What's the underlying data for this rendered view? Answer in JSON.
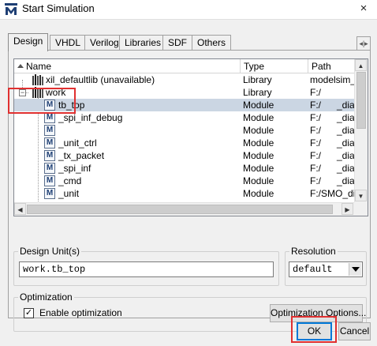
{
  "window": {
    "title": "Start Simulation",
    "close_symbol": "×",
    "logo_icon": "modelsim-m-logo"
  },
  "tabs": [
    {
      "label": "Design",
      "active": true
    },
    {
      "label": "VHDL",
      "active": false
    },
    {
      "label": "Verilog",
      "active": false
    },
    {
      "label": "Libraries",
      "active": false
    },
    {
      "label": "SDF",
      "active": false
    },
    {
      "label": "Others",
      "active": false
    }
  ],
  "tab_scroll_label": "◂|▸",
  "tree": {
    "columns": [
      "Name",
      "Type",
      "Path"
    ],
    "rows": [
      {
        "name": "xil_defaultlib  (unavailable)",
        "type": "Library",
        "path": "modelsim_lil",
        "kind": "library",
        "level": 0,
        "expander": ""
      },
      {
        "name": "work",
        "type": "Library",
        "path": "F:/",
        "kind": "library",
        "level": 0,
        "expander": "−"
      },
      {
        "name": "tb_top",
        "type": "Module",
        "path": "F:/",
        "path_suffix": "_dia",
        "kind": "module",
        "level": 1,
        "selected": true
      },
      {
        "name": "_spi_inf_debug",
        "type": "Module",
        "path": "F:/",
        "path_suffix": "_dia",
        "kind": "module",
        "level": 1
      },
      {
        "name": "",
        "type": "Module",
        "path": "F:/",
        "path_suffix": "_dia",
        "kind": "module",
        "level": 1
      },
      {
        "name": "_unit_ctrl",
        "type": "Module",
        "path": "F:/",
        "path_suffix": "_dia",
        "kind": "module",
        "level": 1
      },
      {
        "name": "_tx_packet",
        "type": "Module",
        "path": "F:/",
        "path_suffix": "_dia",
        "kind": "module",
        "level": 1
      },
      {
        "name": "_spi_inf",
        "type": "Module",
        "path": "F:/",
        "path_suffix": "_dia",
        "kind": "module",
        "level": 1
      },
      {
        "name": "_cmd",
        "type": "Module",
        "path": "F:/",
        "path_suffix": "_dia",
        "kind": "module",
        "level": 1
      },
      {
        "name": "_unit",
        "type": "Module",
        "path": "F:/SMO_dia",
        "path_suffix": "",
        "kind": "module",
        "level": 1
      }
    ]
  },
  "design_unit": {
    "label": "Design Unit(s)",
    "value": "work.tb_top"
  },
  "resolution": {
    "label": "Resolution",
    "value": "default"
  },
  "optimization": {
    "label": "Optimization",
    "checkbox_label": "Enable optimization",
    "checked": true,
    "check_symbol": "✓",
    "options_button": "Optimization Options..."
  },
  "buttons": {
    "ok": "OK",
    "cancel": "Cancel"
  },
  "colors": {
    "selection": "#cbd6e3",
    "highlight_box": "#e03030",
    "default_button_border": "#0078d7"
  }
}
